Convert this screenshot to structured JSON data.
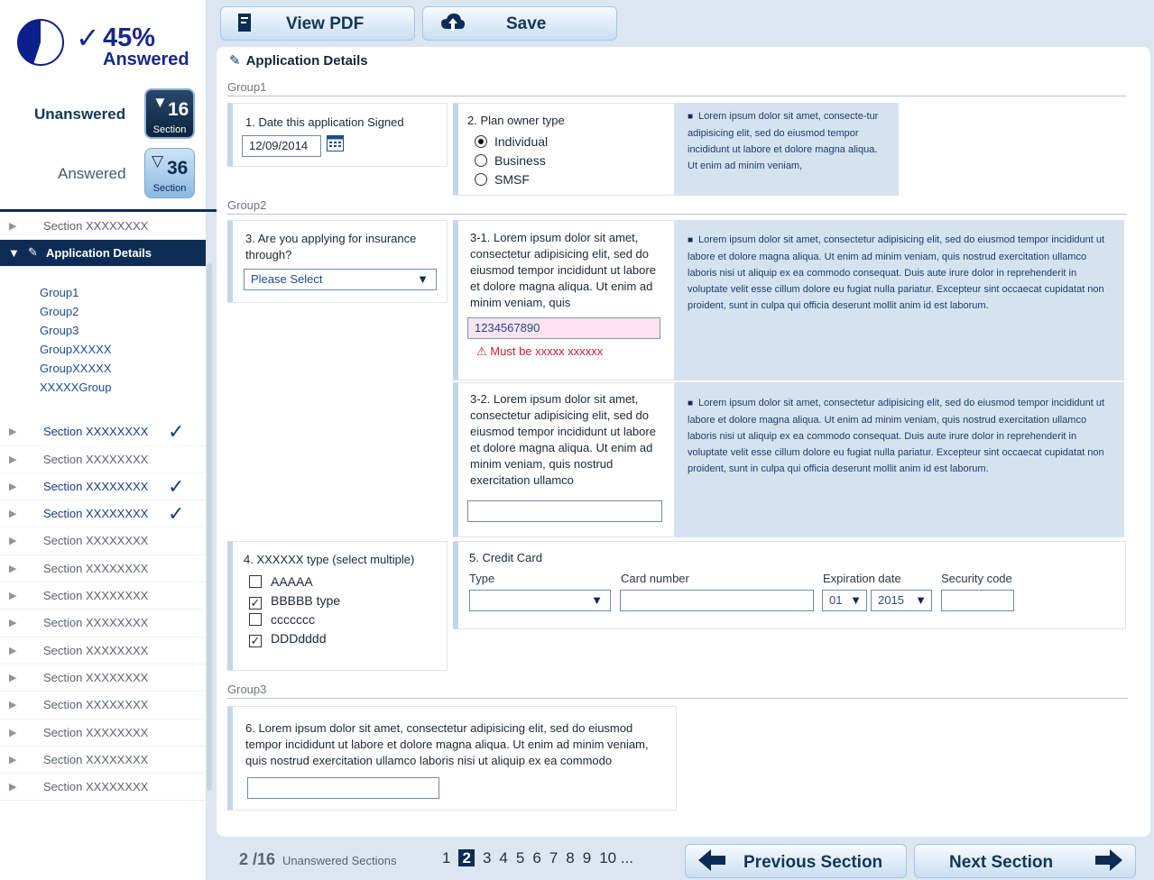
{
  "progress": {
    "percent": "45%",
    "answered_word": "Answered",
    "answered_fraction": 0.45,
    "check": "✓"
  },
  "counts": {
    "unanswered_label": "Unanswered",
    "unanswered_value": "16",
    "answered_label": "Answered",
    "answered_value": "36",
    "section_word": "Section"
  },
  "sidebar": {
    "top_item": "Section XXXXXXXX",
    "active_item": "Application Details",
    "groups": [
      "Group1",
      "Group2",
      "Group3",
      "GroupXXXXX",
      "GroupXXXXX",
      "XXXXXGroup"
    ],
    "items": [
      {
        "label": "Section XXXXXXXX",
        "done": true
      },
      {
        "label": "Section XXXXXXXX",
        "done": false
      },
      {
        "label": "Section XXXXXXXX",
        "done": true
      },
      {
        "label": "Section XXXXXXXX",
        "done": true
      },
      {
        "label": "Section XXXXXXXX",
        "done": false
      },
      {
        "label": "Section XXXXXXXX",
        "done": false
      },
      {
        "label": "Section XXXXXXXX",
        "done": false
      },
      {
        "label": "Section XXXXXXXX",
        "done": false
      },
      {
        "label": "Section XXXXXXXX",
        "done": false
      },
      {
        "label": "Section XXXXXXXX",
        "done": false
      },
      {
        "label": "Section XXXXXXXX",
        "done": false
      },
      {
        "label": "Section XXXXXXXX",
        "done": false
      },
      {
        "label": "Section XXXXXXXX",
        "done": false
      },
      {
        "label": "Section XXXXXXXX",
        "done": false
      }
    ]
  },
  "toolbar": {
    "view_pdf": "View PDF",
    "save": "Save"
  },
  "main": {
    "title": "Application Details",
    "group1": "Group1",
    "group2": "Group2",
    "group3": "Group3",
    "q1": {
      "label": "1. Date this application Signed",
      "value": "12/09/2014"
    },
    "q2": {
      "label": "2. Plan owner type",
      "options": [
        "Individual",
        "Business",
        "SMSF"
      ],
      "selected": "Individual"
    },
    "tip1": "Lorem ipsum dolor sit amet, consecte-tur adipisicing elit, sed do eiusmod tempor incididunt ut labore et dolore magna aliqua. Ut enim ad minim veniam,",
    "q3": {
      "label": "3. Are you applying for insurance through?",
      "select_value": "Please Select"
    },
    "q31": {
      "label": "3-1. Lorem ipsum dolor sit amet, consectetur adipisicing elit, sed do eiusmod tempor incididunt ut labore et dolore magna aliqua. Ut enim ad minim veniam, quis",
      "value": "1234567890",
      "error": "Must be xxxxx xxxxxx"
    },
    "tip31": "Lorem ipsum dolor sit amet, consectetur adipisicing elit, sed do eiusmod tempor incididunt ut labore et dolore magna aliqua. Ut enim ad minim veniam, quis nostrud exercitation ullamco laboris nisi ut aliquip ex ea commodo consequat. Duis aute irure dolor in reprehenderit in voluptate velit esse cillum dolore eu fugiat nulla pariatur. Excepteur sint occaecat cupidatat non proident, sunt in culpa qui officia deserunt mollit anim id est laborum.",
    "q32": {
      "label": "3-2.  Lorem ipsum dolor sit amet, consectetur adipisicing elit, sed do eiusmod tempor incididunt ut labore et dolore magna aliqua. Ut enim ad minim veniam, quis nostrud exercitation ullamco",
      "value": ""
    },
    "tip32": "Lorem ipsum dolor sit amet, consectetur adipisicing elit, sed do eiusmod tempor incididunt ut labore et dolore magna aliqua. Ut enim ad minim veniam, quis nostrud exercitation ullamco laboris nisi ut aliquip ex ea commodo consequat. Duis aute irure dolor in reprehenderit in voluptate velit esse cillum dolore eu fugiat nulla pariatur. Excepteur sint occaecat cupidatat non proident, sunt in culpa qui officia deserunt mollit anim id est laborum.",
    "q4": {
      "label": "4. XXXXXX type (select multiple)",
      "options": [
        {
          "label": "AAAAA",
          "checked": false
        },
        {
          "label": "BBBBB type",
          "checked": true
        },
        {
          "label": "ccccccc",
          "checked": false
        },
        {
          "label": "DDDdddd",
          "checked": true
        }
      ]
    },
    "q5": {
      "label": "5. Credit Card",
      "type_label": "Type",
      "card_label": "Card number",
      "expiry_label": "Expiration date",
      "security_label": "Security code",
      "month": "01",
      "year": "2015"
    },
    "q6": {
      "label": "6. Lorem ipsum dolor sit amet, consectetur adipisicing elit, sed do eiusmod tempor incididunt ut labore et dolore magna aliqua. Ut enim ad minim veniam, quis nostrud exercitation ullamco laboris nisi ut aliquip ex ea commodo",
      "value": ""
    }
  },
  "footer": {
    "count": "2 /16",
    "caption": "Unanswered Sections",
    "pages": [
      "1",
      "2",
      "3",
      "4",
      "5",
      "6",
      "7",
      "8",
      "9",
      "10 ..."
    ],
    "current_page": "2",
    "prev": "Previous Section",
    "next": "Next Section"
  },
  "colors": {
    "navy": "#0d2c55",
    "accent": "#18288a",
    "error": "#d11e2b",
    "tip_bg": "#d5e3f0"
  }
}
